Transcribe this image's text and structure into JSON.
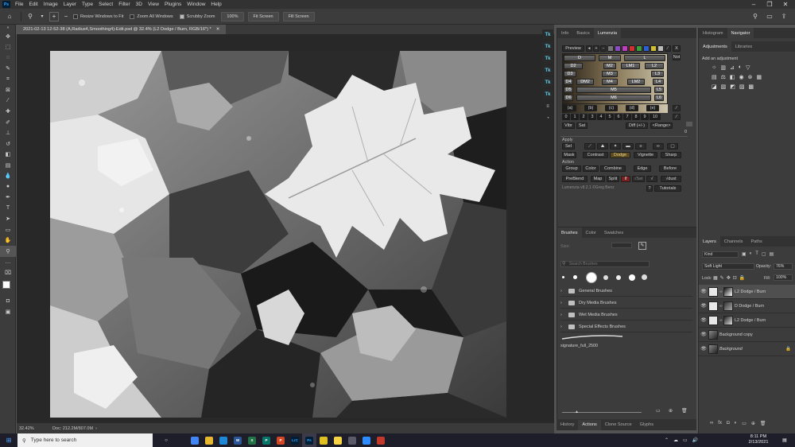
{
  "menubar": {
    "logo": "Ps",
    "items": [
      "File",
      "Edit",
      "Image",
      "Layer",
      "Type",
      "Select",
      "Filter",
      "3D",
      "View",
      "Plugins",
      "Window",
      "Help"
    ]
  },
  "options": {
    "resize_windows": "Resize Windows to Fit",
    "zoom_all": "Zoom All Windows",
    "scrubby_zoom": "Scrubby Zoom",
    "zoom_pct": "100%",
    "fit_screen": "Fit Screen",
    "fill_screen": "Fill Screen"
  },
  "document": {
    "tab_title": "2021-02-13 12-52-38 (A,Radius4,Smoothing4)-Edit.psd @ 32.4% (L2 Dodge / Burn, RGB/16*) *",
    "zoom": "32.42%",
    "doc_info": "Doc: 212.2M/807.0M"
  },
  "lumenzia": {
    "tabs": [
      "Info",
      "Basics",
      "Lumenzia"
    ],
    "preview": "Preview",
    "close": "X",
    "not": "Not",
    "zone_rows": [
      [
        "D",
        "M",
        "L"
      ],
      [
        "D2",
        "M2",
        "LM1",
        "L2"
      ],
      [
        "D3",
        "M3",
        "L3"
      ],
      [
        "D4",
        "DM2",
        "M4",
        "LM2",
        "L4"
      ],
      [
        "D5",
        "M5",
        "L5"
      ],
      [
        "D6",
        "M6",
        "L6"
      ]
    ],
    "bracket_row": [
      "(a)",
      "(b)",
      "(c)",
      "(d)",
      "(e)"
    ],
    "num_row": [
      "0",
      "1",
      "2",
      "3",
      "4",
      "5",
      "6",
      "7",
      "8",
      "9",
      "10"
    ],
    "vibr": "Vibr",
    "sat": "Sat",
    "diff": "Diff (+/-)",
    "range": "<Range>",
    "apply_label": "Apply",
    "sel": "Sel",
    "mask": "Mask",
    "contrast": "Contrast",
    "dodge": "Dodge",
    "vignette": "Vignette",
    "sharp": "Sharp",
    "action_label": "Action",
    "group": "Group",
    "color": "Color",
    "combine": "Combine",
    "edge": "Edge",
    "before": "Before",
    "preblend": "PreBlend",
    "map": "Map",
    "split": "Split",
    "if": "If",
    "vsel": "√Sel",
    "vdust": "√dust",
    "version": "Lumenzia v8.2.1 ©Greg Benz",
    "help": "?",
    "tutorials": "Tutorials",
    "side_num": "0"
  },
  "right_top": {
    "tabs": [
      "Histogram",
      "Navigator"
    ],
    "adj_tabs": [
      "Adjustments",
      "Libraries"
    ],
    "add_adjustment": "Add an adjustment"
  },
  "brushes": {
    "tabs": [
      "Brushes",
      "Color",
      "Swatches"
    ],
    "size_label": "Size:",
    "search_placeholder": "Search Brushes",
    "folders": [
      "General Brushes",
      "Dry Media Brushes",
      "Wet Media Brushes",
      "Special Effects Brushes"
    ],
    "preset": "signature_full_2500"
  },
  "bottom_tabs": [
    "History",
    "Actions",
    "Clone Source",
    "Glyphs"
  ],
  "layers": {
    "tabs": [
      "Layers",
      "Channels",
      "Paths"
    ],
    "kind": "Kind",
    "blend_mode": "Soft Light",
    "opacity_label": "Opacity:",
    "opacity": "76%",
    "lock_label": "Lock:",
    "fill_label": "Fill:",
    "fill": "100%",
    "items": [
      {
        "name": "L2 Dodge / Burn"
      },
      {
        "name": "D Dodge / Burn"
      },
      {
        "name": "L2 Dodge / Burn"
      },
      {
        "name": "Background copy"
      },
      {
        "name": "Background"
      }
    ]
  },
  "taskbar": {
    "search": "Type here to search",
    "time": "8:11 PM",
    "date": "2/13/2021",
    "apps": [
      {
        "name": "task-view",
        "label": "",
        "color": "#1e1e2a"
      },
      {
        "name": "chrome",
        "label": "",
        "color": "#4285f4"
      },
      {
        "name": "file-explorer",
        "label": "",
        "color": "#e8b730"
      },
      {
        "name": "edge",
        "label": "",
        "color": "#1e88d6"
      },
      {
        "name": "word",
        "label": "W",
        "color": "#2b5797"
      },
      {
        "name": "excel",
        "label": "X",
        "color": "#217346"
      },
      {
        "name": "publisher",
        "label": "P",
        "color": "#077568"
      },
      {
        "name": "powerpoint",
        "label": "P",
        "color": "#d24726"
      },
      {
        "name": "lightroom-classic",
        "label": "LrC",
        "color": "#001e36"
      },
      {
        "name": "photoshop",
        "label": "Ps",
        "color": "#001e36"
      },
      {
        "name": "app-yellow",
        "label": "",
        "color": "#e0c020"
      },
      {
        "name": "sticky-notes",
        "label": "",
        "color": "#f7d345"
      },
      {
        "name": "calculator",
        "label": "",
        "color": "#5a5a6a"
      },
      {
        "name": "zoom",
        "label": "",
        "color": "#2d8cff"
      },
      {
        "name": "app-red",
        "label": "",
        "color": "#c0392b"
      }
    ]
  }
}
